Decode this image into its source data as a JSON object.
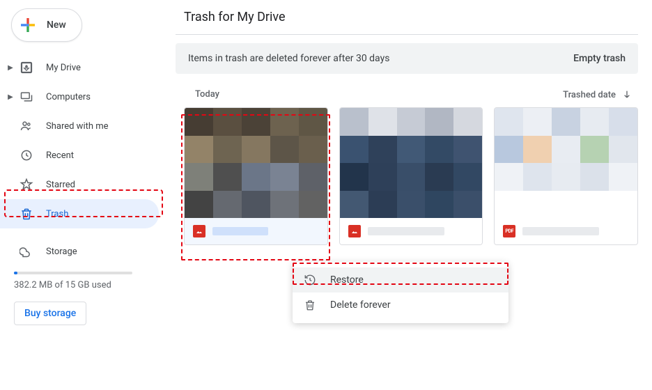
{
  "new_button": {
    "label": "New"
  },
  "sidebar": {
    "items": [
      {
        "label": "My Drive",
        "expandable": true
      },
      {
        "label": "Computers",
        "expandable": true
      },
      {
        "label": "Shared with me",
        "expandable": false
      },
      {
        "label": "Recent",
        "expandable": false
      },
      {
        "label": "Starred",
        "expandable": false
      },
      {
        "label": "Trash",
        "expandable": false,
        "active": true
      }
    ],
    "storage_label": "Storage",
    "storage_text": "382.2 MB of 15 GB used",
    "buy_storage": "Buy storage"
  },
  "main": {
    "title": "Trash for My Drive",
    "banner_text": "Items in trash are deleted forever after 30 days",
    "empty_trash": "Empty trash",
    "group_label": "Today",
    "sort_label": "Trashed date"
  },
  "files": [
    {
      "type": "image",
      "selected": true
    },
    {
      "type": "image",
      "selected": false
    },
    {
      "type": "pdf",
      "selected": false
    }
  ],
  "context_menu": {
    "restore": "Restore",
    "delete": "Delete forever"
  }
}
